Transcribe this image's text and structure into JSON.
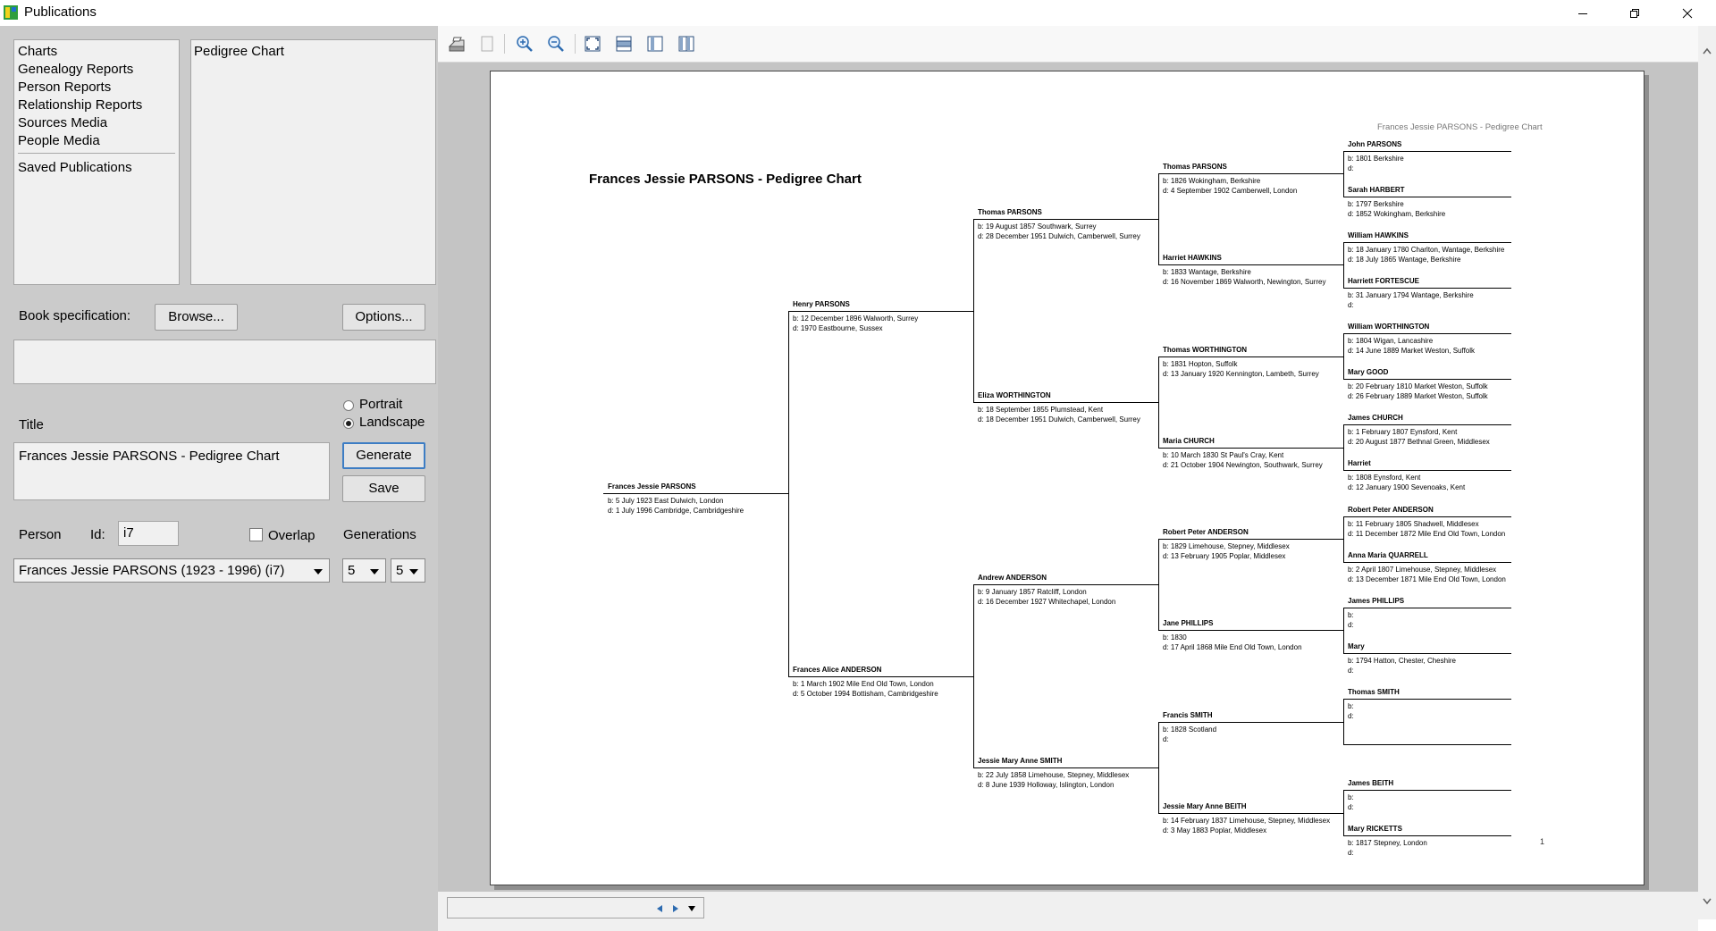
{
  "window": {
    "title": "Publications"
  },
  "left": {
    "categories": [
      "Charts",
      "Genealogy Reports",
      "Person Reports",
      "Relationship Reports",
      "Sources Media",
      "People Media"
    ],
    "saved": "Saved Publications",
    "types": [
      "Pedigree Chart"
    ],
    "book_spec_label": "Book specification:",
    "browse": "Browse...",
    "options": "Options...",
    "portrait": "Portrait",
    "landscape": "Landscape",
    "orientation_selected": "Landscape",
    "title_label": "Title",
    "title_value": "Frances Jessie PARSONS - Pedigree Chart",
    "generate": "Generate",
    "save": "Save",
    "person_label": "Person",
    "id_label": "Id:",
    "id_value": "i7",
    "overlap_label": "Overlap",
    "generations_label": "Generations",
    "person_value": "Frances Jessie PARSONS  (1923 - 1996)  (i7)",
    "gen1": "5",
    "gen2": "5"
  },
  "chart": {
    "title": "Frances Jessie PARSONS - Pedigree Chart",
    "header": "Frances Jessie PARSONS - Pedigree Chart",
    "page_number": "1",
    "people": [
      {
        "name": "Frances Jessie PARSONS",
        "b": "b: 5 July 1923 East Dulwich, London",
        "d": "d: 1 July 1996 Cambridge, Cambridgeshire"
      },
      {
        "name": "Henry PARSONS",
        "b": "b: 12 December 1896 Walworth, Surrey",
        "d": "d: 1970 Eastbourne, Sussex"
      },
      {
        "name": "Frances Alice ANDERSON",
        "b": "b: 1 March 1902 Mile End Old Town, London",
        "d": "d: 5 October 1994 Bottisham, Cambridgeshire"
      },
      {
        "name": "Thomas PARSONS",
        "b": "b: 19 August 1857 Southwark, Surrey",
        "d": "d: 28 December 1951 Dulwich, Camberwell, Surrey"
      },
      {
        "name": "Eliza WORTHINGTON",
        "b": "b: 18 September 1855 Plumstead, Kent",
        "d": "d: 18 December 1951 Dulwich, Camberwell, Surrey"
      },
      {
        "name": "Andrew ANDERSON",
        "b": "b: 9 January 1857 Ratcliff, London",
        "d": "d: 16 December 1927 Whitechapel, London"
      },
      {
        "name": "Jessie Mary Anne SMITH",
        "b": "b: 22 July 1858 Limehouse, Stepney, Middlesex",
        "d": "d: 8 June 1939 Holloway, Islington, London"
      },
      {
        "name": "Thomas PARSONS",
        "b": "b: 1826 Wokingham, Berkshire",
        "d": "d: 4 September 1902 Camberwell, London"
      },
      {
        "name": "Harriet HAWKINS",
        "b": "b: 1833 Wantage, Berkshire",
        "d": "d: 16 November 1869 Walworth, Newington, Surrey"
      },
      {
        "name": "Thomas WORTHINGTON",
        "b": "b: 1831 Hopton, Suffolk",
        "d": "d: 13 January 1920 Kennington, Lambeth, Surrey"
      },
      {
        "name": "Maria CHURCH",
        "b": "b: 10 March 1830 St Paul's Cray, Kent",
        "d": "d: 21 October 1904 Newington, Southwark, Surrey"
      },
      {
        "name": "Robert Peter ANDERSON",
        "b": "b: 1829 Limehouse, Stepney, Middlesex",
        "d": "d: 13 February 1905 Poplar, Middlesex"
      },
      {
        "name": "Jane PHILLIPS",
        "b": "b: 1830",
        "d": "d: 17 April 1868 Mile End Old Town, London"
      },
      {
        "name": "Francis SMITH",
        "b": "b: 1828 Scotland",
        "d": "d:"
      },
      {
        "name": "Jessie Mary Anne BEITH",
        "b": "b: 14 February 1837 Limehouse, Stepney, Middlesex",
        "d": "d: 3 May 1883 Poplar, Middlesex"
      },
      {
        "name": "John PARSONS",
        "b": "b: 1801 Berkshire",
        "d": "d:"
      },
      {
        "name": "Sarah HARBERT",
        "b": "b: 1797 Berkshire",
        "d": "d: 1852 Wokingham, Berkshire"
      },
      {
        "name": "William HAWKINS",
        "b": "b: 18 January 1780 Charlton, Wantage, Berkshire",
        "d": "d: 18 July 1865 Wantage, Berkshire"
      },
      {
        "name": "Harriett FORTESCUE",
        "b": "b: 31 January 1794 Wantage, Berkshire",
        "d": "d:"
      },
      {
        "name": "William WORTHINGTON",
        "b": "b: 1804 Wigan, Lancashire",
        "d": "d: 14 June 1889 Market Weston, Suffolk"
      },
      {
        "name": "Mary GOOD",
        "b": "b: 20 February 1810 Market Weston, Suffolk",
        "d": "d: 26 February 1889 Market Weston, Suffolk"
      },
      {
        "name": "James CHURCH",
        "b": "b: 1 February 1807 Eynsford, Kent",
        "d": "d: 20 August 1877 Bethnal Green, Middlesex"
      },
      {
        "name": "Harriet",
        "b": "b: 1808 Eynsford, Kent",
        "d": "d: 12 January 1900 Sevenoaks, Kent"
      },
      {
        "name": "Robert Peter ANDERSON",
        "b": "b: 11 February 1805 Shadwell, Middlesex",
        "d": "d: 11 December 1872 Mile End Old Town, London"
      },
      {
        "name": "Anna Maria QUARRELL",
        "b": "b: 2 April 1807 Limehouse, Stepney, Middlesex",
        "d": "d: 13 December 1871 Mile End Old Town, London"
      },
      {
        "name": "James PHILLIPS",
        "b": "b:",
        "d": "d:"
      },
      {
        "name": "Mary",
        "b": "b: 1794 Hatton, Chester, Cheshire",
        "d": "d:"
      },
      {
        "name": "Thomas SMITH",
        "b": "b:",
        "d": "d:"
      },
      {
        "name": "",
        "b": "",
        "d": ""
      },
      {
        "name": "James BEITH",
        "b": "b:",
        "d": "d:"
      },
      {
        "name": "Mary RICKETTS",
        "b": "b: 1817 Stepney, London",
        "d": "d:"
      }
    ]
  }
}
